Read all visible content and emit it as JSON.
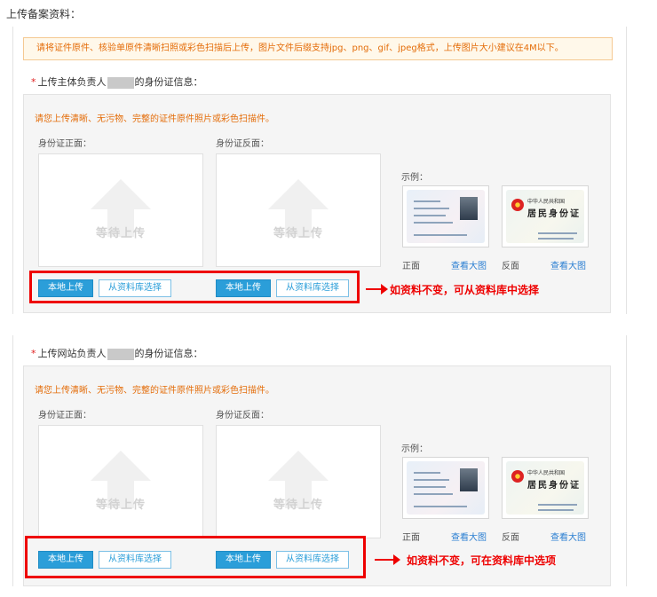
{
  "page": {
    "title": "上传备案资料："
  },
  "notice": "请将证件原件、核验单原件清晰扫照或彩色扫描后上传，图片文件后缀支持jpg、png、gif、jpeg格式，上传图片大小建议在4M以下。",
  "sections": [
    {
      "label_prefix": "上传主体负责人",
      "label_suffix": "的身份证信息：",
      "tip": "请您上传清晰、无污物、完整的证件原件照片或彩色扫描件。",
      "front_label": "身份证正面：",
      "back_label": "身份证反面：",
      "placeholder": "等待上传",
      "btn_local": "本地上传",
      "btn_library": "从资料库选择",
      "example_label": "示例：",
      "front_caption": "正面",
      "back_caption": "反面",
      "view_large": "查看大图",
      "annotation": "如资料不变，可从资料库中选择"
    },
    {
      "label_prefix": "上传网站负责人",
      "label_suffix": "的身份证信息：",
      "tip": "请您上传清晰、无污物、完整的证件原件照片或彩色扫描件。",
      "front_label": "身份证正面：",
      "back_label": "身份证反面：",
      "placeholder": "等待上传",
      "btn_local": "本地上传",
      "btn_library": "从资料库选择",
      "example_label": "示例：",
      "front_caption": "正面",
      "back_caption": "反面",
      "view_large": "查看大图",
      "annotation": "如资料不变，可在资料库中选项"
    }
  ],
  "sample_card_back": {
    "title": "中华人民共和国",
    "big": "居民身份证"
  },
  "colors": {
    "accent": "#2b9ed9",
    "warning": "#e46d0a",
    "highlight": "#ee0000"
  }
}
